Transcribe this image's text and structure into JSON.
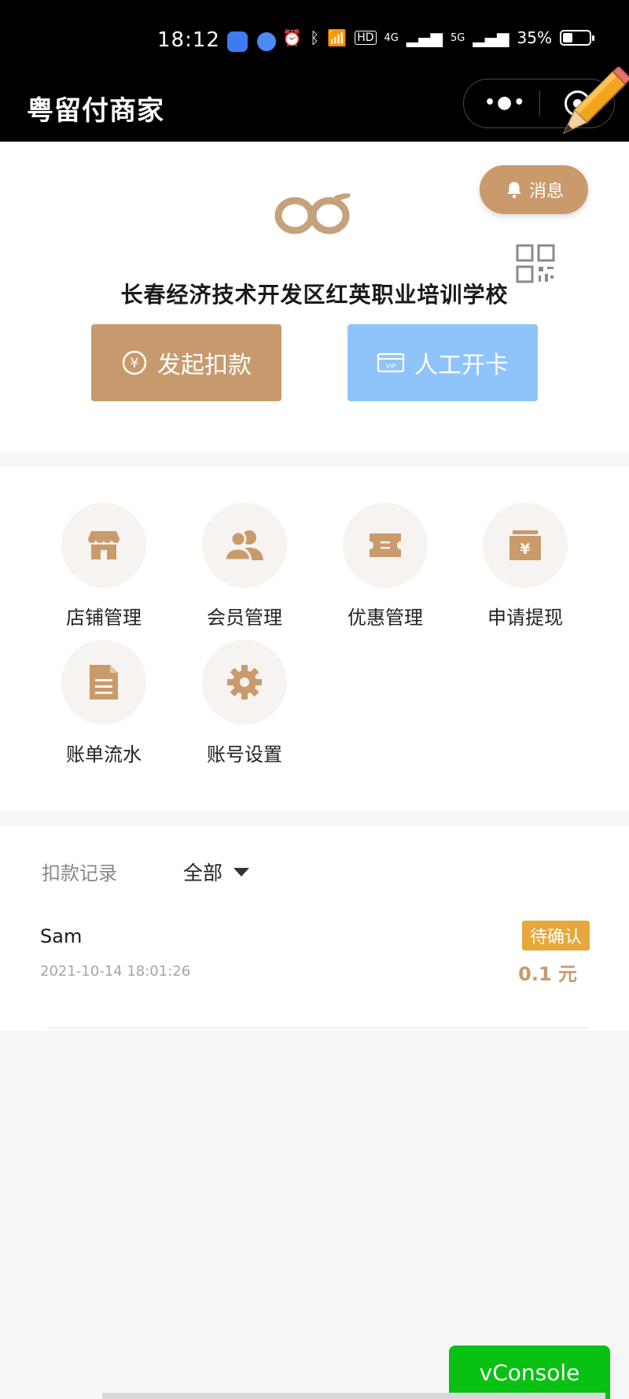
{
  "status_bar": {
    "time": "18:12",
    "network_hd": "HD",
    "network_4g": "4G",
    "network_5g": "5G",
    "battery": "35%"
  },
  "navbar": {
    "title": "粤留付商家"
  },
  "header": {
    "message_label": "消息",
    "school_name": "长春经济技术开发区红英职业培训学校",
    "pay_button": "发起扣款",
    "card_button": "人工开卡",
    "vip_tag": "VIP"
  },
  "menu": {
    "items": [
      {
        "label": "店铺管理",
        "icon": "store-icon"
      },
      {
        "label": "会员管理",
        "icon": "members-icon"
      },
      {
        "label": "优惠管理",
        "icon": "coupon-icon"
      },
      {
        "label": "申请提现",
        "icon": "withdraw-icon"
      },
      {
        "label": "账单流水",
        "icon": "bill-icon"
      },
      {
        "label": "账号设置",
        "icon": "settings-icon"
      }
    ]
  },
  "records": {
    "title": "扣款记录",
    "filter": "全部",
    "rows": [
      {
        "name": "Sam",
        "time": "2021-10-14 18:01:26",
        "status": "待确认",
        "amount": "0.1 元"
      }
    ]
  },
  "vconsole_label": "vConsole",
  "colors": {
    "accent": "#c99a6b",
    "card_blue": "#8fc4fb",
    "status_orange": "#e6a83a",
    "vconsole_green": "#09c113"
  }
}
